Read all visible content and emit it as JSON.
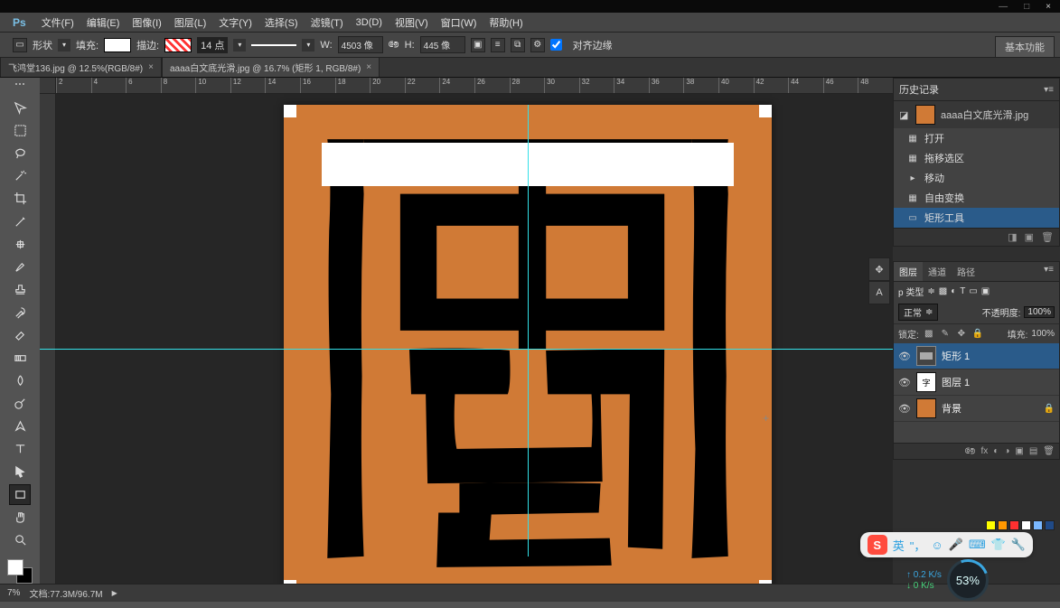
{
  "window": {
    "min": "—",
    "max": "□",
    "close": "×"
  },
  "menu": {
    "items": [
      "文件(F)",
      "编辑(E)",
      "图像(I)",
      "图层(L)",
      "文字(Y)",
      "选择(S)",
      "滤镜(T)",
      "3D(D)",
      "视图(V)",
      "窗口(W)",
      "帮助(H)"
    ]
  },
  "options": {
    "shape_lbl": "形状",
    "fill_lbl": "填充:",
    "stroke_lbl": "描边:",
    "stroke_pt": "14 点",
    "w_lbl": "W:",
    "w_val": "4503 像",
    "h_lbl": "H:",
    "h_val": "445 像",
    "align_edges": "对齐边缘"
  },
  "workspace_btn": "基本功能",
  "tabs": [
    {
      "title": "飞鸿堂136.jpg @ 12.5%(RGB/8#)",
      "active": false
    },
    {
      "title": "aaaa白文底光滑.jpg @ 16.7% (矩形 1, RGB/8#)",
      "active": true
    }
  ],
  "ruler_h": [
    "2",
    "4",
    "6",
    "8",
    "10",
    "12",
    "14",
    "16",
    "18",
    "20",
    "22",
    "24",
    "26",
    "28",
    "30",
    "32",
    "34",
    "36",
    "38",
    "40",
    "42",
    "44",
    "46",
    "48"
  ],
  "history": {
    "title": "历史记录",
    "doc": "aaaa白文底光滑.jpg",
    "items": [
      {
        "label": "打开"
      },
      {
        "label": "拖移选区"
      },
      {
        "label": "移动"
      },
      {
        "label": "自由变换"
      },
      {
        "label": "矩形工具",
        "sel": true
      }
    ]
  },
  "layers": {
    "tabs": [
      "图层",
      "通道",
      "路径"
    ],
    "kind_lbl": "p 类型",
    "blend": "正常",
    "opacity_lbl": "不透明度:",
    "opacity_val": "100%",
    "lock_lbl": "锁定:",
    "fill_lbl": "填充:",
    "fill_val": "100%",
    "items": [
      {
        "name": "矩形 1",
        "sel": true,
        "thumb": "rect"
      },
      {
        "name": "图层 1",
        "thumb": "seal"
      },
      {
        "name": "背景",
        "thumb": "orange",
        "locked": true
      }
    ]
  },
  "status": {
    "zoom": "7%",
    "doc": "文档:77.3M/96.7M"
  },
  "ime": {
    "s": "S",
    "lang": "英"
  },
  "net": {
    "up": "↑ 0.2 K/s",
    "dn": "↓ 0 K/s",
    "pct": "53%"
  },
  "chips": [
    "#ffff00",
    "#ff9800",
    "#ff3030",
    "#ffffff",
    "#7ab8ff",
    "#204a87"
  ]
}
